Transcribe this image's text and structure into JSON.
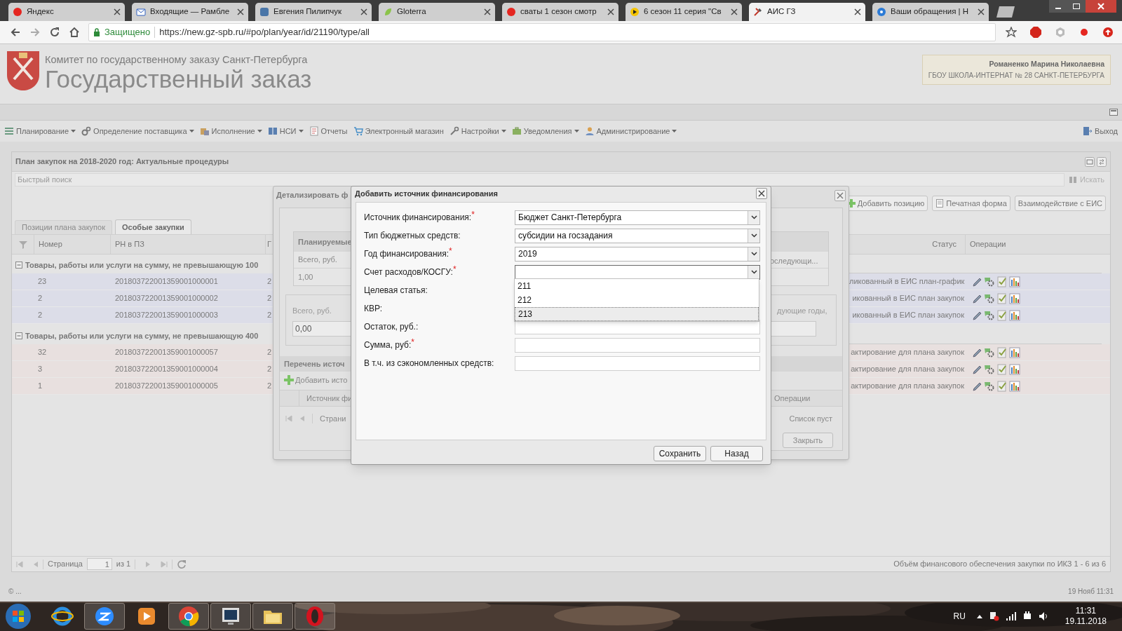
{
  "browser": {
    "tabs": [
      {
        "title": "Яндекс",
        "kind": "yandex",
        "selected": false
      },
      {
        "title": "Входящие — Рамбле",
        "kind": "mail",
        "selected": false
      },
      {
        "title": "Евгения Пилипчук",
        "kind": "vk",
        "selected": false
      },
      {
        "title": "Gloterra",
        "kind": "leaf",
        "selected": false
      },
      {
        "title": "сваты 1 сезон смотр",
        "kind": "yandex",
        "selected": false
      },
      {
        "title": "6 сезон 11 серия \"Св",
        "kind": "play",
        "selected": false
      },
      {
        "title": "АИС ГЗ",
        "kind": "tools",
        "selected": true
      },
      {
        "title": "Ваши обращения | Н",
        "kind": "help",
        "selected": false
      }
    ],
    "address": {
      "secure_label": "Защищено",
      "url": "https://new.gz-spb.ru/#po/plan/year/id/21190/type/all"
    }
  },
  "header": {
    "org": "Комитет по государственному заказу Санкт-Петербурга",
    "title": "Государственный заказ",
    "user_name": "Романенко Марина Николаевна",
    "user_org": "ГБОУ ШКОЛА-ИНТЕРНАТ № 28 САНКТ-ПЕТЕРБУРГА"
  },
  "menu": {
    "items": [
      {
        "label": "Планирование",
        "kind": "plan",
        "dropdown": true
      },
      {
        "label": "Определение поставщика",
        "kind": "supplier",
        "dropdown": true
      },
      {
        "label": "Исполнение",
        "kind": "exec",
        "dropdown": true
      },
      {
        "label": "НСИ",
        "kind": "book",
        "dropdown": true
      },
      {
        "label": "Отчеты",
        "kind": "report",
        "dropdown": false
      },
      {
        "label": "Электронный магазин",
        "kind": "shop",
        "dropdown": false
      },
      {
        "label": "Настройки",
        "kind": "settings",
        "dropdown": true
      },
      {
        "label": "Уведомления",
        "kind": "notify",
        "dropdown": true
      },
      {
        "label": "Администрирование",
        "kind": "admin",
        "dropdown": true
      }
    ],
    "exit": "Выход"
  },
  "panel": {
    "title": "План закупок на 2018-2020 год: Актуальные процедуры",
    "search": {
      "placeholder": "Быстрый поиск",
      "button": "Искать"
    },
    "toolbar": [
      {
        "label": "Добавить позицию",
        "kind": "add"
      },
      {
        "label": "Печатная форма",
        "kind": "print"
      },
      {
        "label": "Взаимодействие с ЕИС"
      }
    ],
    "tabs": [
      {
        "label": "Позиции плана закупок",
        "selected": false
      },
      {
        "label": "Особые закупки",
        "selected": true
      }
    ],
    "columns": [
      "Номер",
      "РН в ПЗ",
      "Г",
      "Статус",
      "Операции"
    ],
    "groups": [
      {
        "label": "Товары, работы или услуги на сумму, не превышающую 100",
        "expanded": true,
        "color": "#dcdde8",
        "rows": [
          {
            "number": "23",
            "rn": "201803722001359001000001",
            "column_3": "2",
            "status": "ликованный в ЕИС план-график"
          },
          {
            "number": "2",
            "rn": "201803722001359001000002",
            "column_3": "2",
            "status": "икованный в ЕИС план закупок"
          },
          {
            "number": "2",
            "rn": "201803722001359001000003",
            "column_3": "2",
            "status": "икованный в ЕИС план закупок"
          }
        ]
      },
      {
        "label": "Товары, работы или услуги на сумму, не превышающую 400",
        "expanded": true,
        "color": "#e8e0df",
        "rows": [
          {
            "number": "32",
            "rn": "201803722001359001000057",
            "column_3": "2",
            "status": "актирование для плана закупок"
          },
          {
            "number": "3",
            "rn": "201803722001359001000004",
            "column_3": "2",
            "status": "актирование для плана закупок"
          },
          {
            "number": "1",
            "rn": "201803722001359001000005",
            "column_3": "2",
            "status": "актирование для плана закупок"
          }
        ]
      }
    ],
    "pager": {
      "label": "Страница",
      "page": "1",
      "of": "из 1",
      "summary": "Объём финансового обеспечения закупки по ИКЗ 1 - 6 из 6"
    }
  },
  "detail_window": {
    "title": "Детализировать ф",
    "planned": {
      "header": "Планируемые",
      "total_label": "Всего, руб.",
      "total": "1,00",
      "right_label": "оследующи..."
    },
    "saved": {
      "label": "Всего, руб.",
      "value": "0,00",
      "right_label": "дующие годы,"
    },
    "sources": {
      "title": "Перечень источ",
      "add": "Добавить исто",
      "columns": [
        "Источник фи",
        "Операции"
      ],
      "pager_label": "Страни",
      "empty": "Список пуст"
    },
    "close_button": "Закрыть"
  },
  "dialog": {
    "title": "Добавить источник финансирования",
    "rows": [
      {
        "label": "Источник финансирования:",
        "mark": "*",
        "field": {
          "kind": "combo",
          "value": "Бюджет Санкт-Петербурга"
        }
      },
      {
        "label": "Тип бюджетных средств:",
        "field": {
          "kind": "combo",
          "value": "субсидии на госзадания"
        }
      },
      {
        "label": "Год финансирования:",
        "mark": "*",
        "field": {
          "kind": "combo",
          "value": "2019"
        }
      },
      {
        "label": "Счет расходов/КОСГУ:",
        "mark": "*",
        "field": {
          "kind": "combo",
          "focused": true,
          "options": [
            {
              "label": "211",
              "selected": false
            },
            {
              "label": "212",
              "selected": false
            },
            {
              "label": "213",
              "selected": true
            }
          ]
        }
      },
      {
        "label": "Целевая статья:"
      },
      {
        "label": "КВР:"
      },
      {
        "label": "Остаток, руб.:",
        "field": {
          "kind": "text"
        }
      },
      {
        "label": "Сумма, руб:",
        "mark": "*",
        "field": {
          "kind": "text"
        }
      },
      {
        "label": "В т.ч. из сэкономленных средств:",
        "field": {
          "kind": "text"
        }
      }
    ],
    "buttons": [
      "Сохранить",
      "Назад"
    ]
  },
  "footer": {
    "copyright": "© ...",
    "datetime": "19 Нояб 11:31"
  },
  "taskbar": {
    "apps": [
      {
        "kind": "ie",
        "running": false
      },
      {
        "kind": "zoom",
        "running": true
      },
      {
        "kind": "player",
        "running": false
      },
      {
        "kind": "chrome",
        "running": true
      },
      {
        "kind": "monitor",
        "running": true
      },
      {
        "kind": "folder",
        "running": true
      },
      {
        "kind": "opera",
        "running": true
      }
    ],
    "language": "RU",
    "time": "11:31",
    "date": "19.11.2018"
  }
}
